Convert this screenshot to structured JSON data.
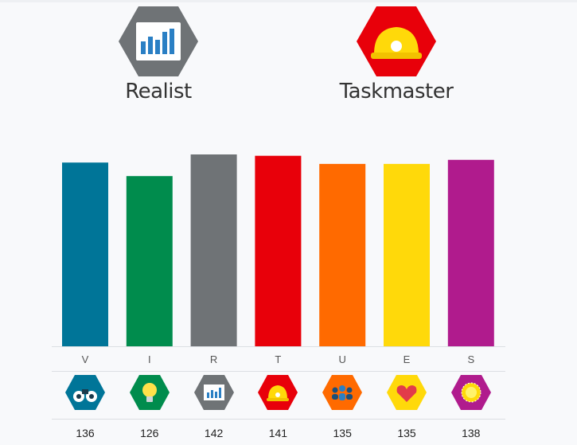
{
  "profile": {
    "primary": {
      "label": "Realist",
      "icon": "bar-chart-icon",
      "color": "#6f7376"
    },
    "secondary": {
      "label": "Taskmaster",
      "icon": "hard-hat-icon",
      "color": "#e8000a"
    }
  },
  "chart_data": {
    "type": "bar",
    "categories": [
      "V",
      "I",
      "R",
      "T",
      "U",
      "E",
      "S"
    ],
    "values": [
      136,
      126,
      142,
      141,
      135,
      135,
      138
    ],
    "colors": [
      "#007598",
      "#008c4d",
      "#6f7376",
      "#e8000a",
      "#ff6a00",
      "#ffd90a",
      "#b01b8d"
    ],
    "icons": [
      "binoculars-icon",
      "lightbulb-icon",
      "bar-chart-icon",
      "hard-hat-icon",
      "people-icon",
      "heart-icon",
      "sun-icon"
    ],
    "title": "",
    "xlabel": "",
    "ylabel": "",
    "ylim": [
      0,
      142
    ],
    "grid": false,
    "legend": "none"
  }
}
